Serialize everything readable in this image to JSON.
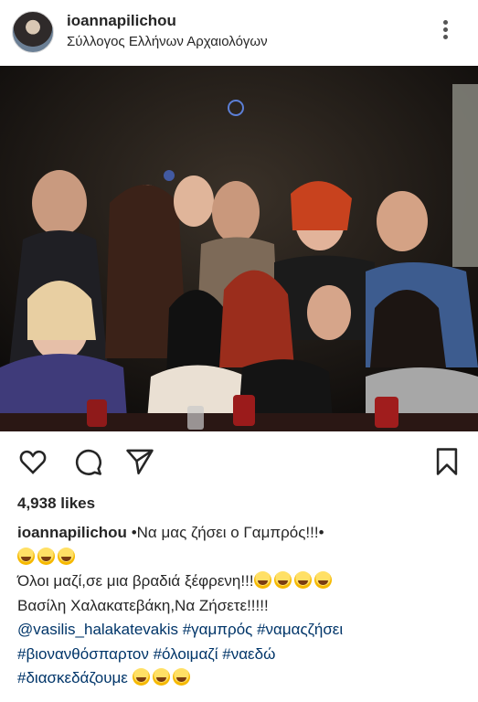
{
  "post": {
    "username": "ioannapilichou",
    "location": "Σύλλογος Ελλήνων Αρχαιολόγων",
    "likes": "4,938 likes"
  },
  "icons": {
    "more": "more-options-icon",
    "like": "heart-icon",
    "comment": "comment-icon",
    "share": "send-icon",
    "save": "bookmark-icon"
  },
  "caption": {
    "username": "ioannapilichou",
    "line1": "•Να μας ζήσει ο Γαμπρός!!!•",
    "line3": "Όλοι μαζί,σε μια βραδιά ξέφρενη!!!",
    "line4": "Βασίλη Χαλακατεβάκη,Να Ζήσετε!!!!!",
    "hashtags_line1": "@vasilis_halakatevakis #γαμπρός #ναμαςζήσει",
    "hashtags_line2": "#βιονανθόσπαρτον #όλοιμαζί #ναεδώ",
    "hashtags_line3": "#διασκεδάζουμε"
  },
  "colors": {
    "text": "#262626",
    "link": "#003569",
    "background": "#ffffff"
  }
}
